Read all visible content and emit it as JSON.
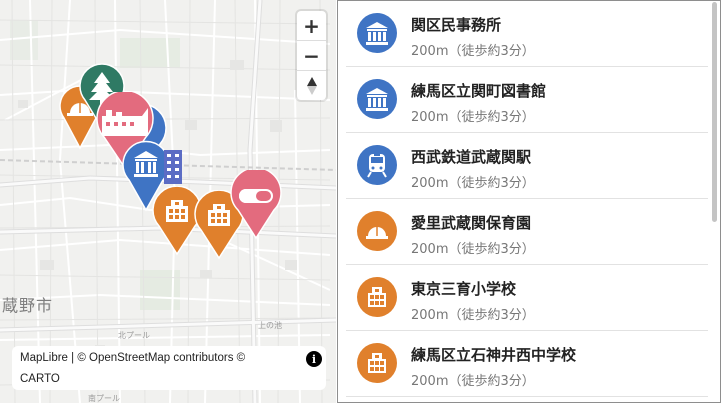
{
  "map": {
    "city_label": "蔵野市",
    "small_labels": [
      "北プール",
      "上の池",
      "南プール"
    ],
    "zoom_in": "+",
    "zoom_out": "−",
    "compass": "▲",
    "attribution": {
      "maplibre": "MapLibre",
      "separator": " | © ",
      "osm": "OpenStreetMap",
      "contributors": " contributors ©",
      "carto": "CARTO",
      "info": "i"
    },
    "pins": [
      {
        "name": "nursery-pin",
        "color": "#e0802c",
        "icon": "helmet-icon"
      },
      {
        "name": "park-pin",
        "color": "#2f7a64",
        "icon": "tree-icon"
      },
      {
        "name": "factory-pin",
        "color": "#e36b7e",
        "icon": "factory-icon"
      },
      {
        "name": "library-pin",
        "color": "#3f74c4",
        "icon": "columns-icon"
      },
      {
        "name": "school-pin-1",
        "color": "#e0802c",
        "icon": "school-icon"
      },
      {
        "name": "school-pin-2",
        "color": "#e0802c",
        "icon": "school-icon"
      },
      {
        "name": "hospital-pin",
        "color": "#e36b7e",
        "icon": "pill-icon"
      }
    ]
  },
  "list": {
    "items": [
      {
        "name": "関区民事務所",
        "distance": "200m（徒歩約3分）",
        "icon": "columns-icon",
        "color": "#3f74c4"
      },
      {
        "name": "練馬区立関町図書館",
        "distance": "200m（徒歩約3分）",
        "icon": "columns-icon",
        "color": "#3f74c4"
      },
      {
        "name": "西武鉄道武蔵関駅",
        "distance": "200m（徒歩約3分）",
        "icon": "train-icon",
        "color": "#3f74c4"
      },
      {
        "name": "愛里武蔵関保育園",
        "distance": "200m（徒歩約3分）",
        "icon": "helmet-icon",
        "color": "#e0802c"
      },
      {
        "name": "東京三育小学校",
        "distance": "200m（徒歩約3分）",
        "icon": "school-icon",
        "color": "#e0802c"
      },
      {
        "name": "練馬区立石神井西中学校",
        "distance": "200m（徒歩約3分）",
        "icon": "school-icon",
        "color": "#e0802c"
      }
    ]
  }
}
